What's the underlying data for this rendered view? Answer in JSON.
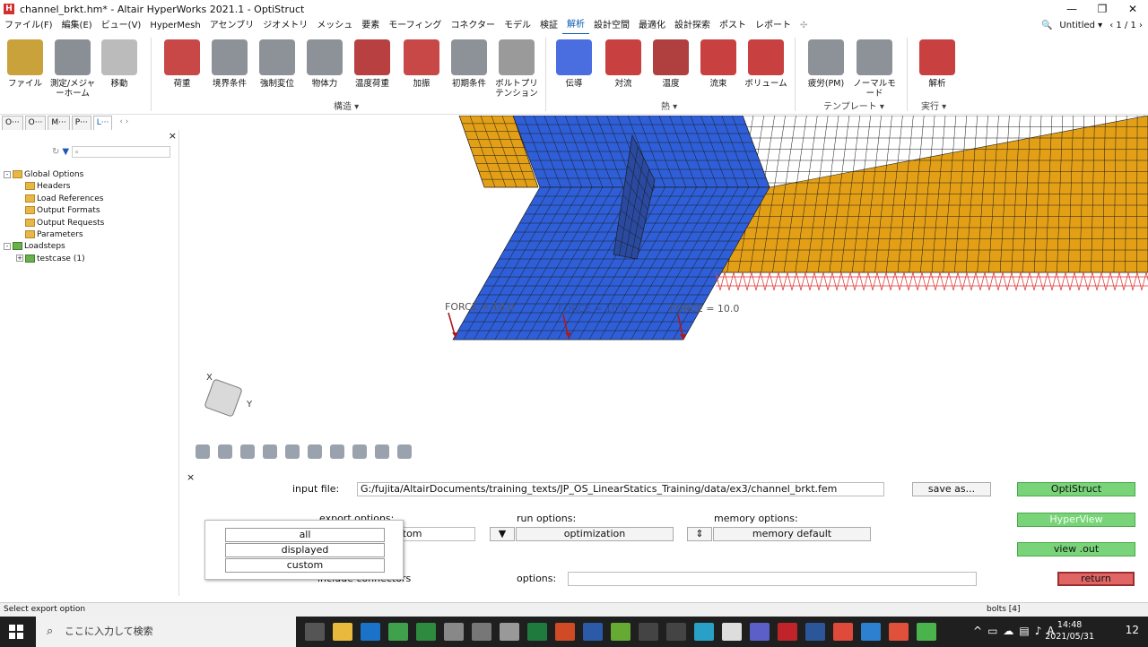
{
  "window": {
    "title": "channel_brkt.hm* - Altair HyperWorks 2021.1 - OptiStruct",
    "app_icon": "hyperworks-icon",
    "minimize": "—",
    "maximize": "❐",
    "close": "✕"
  },
  "menubar": {
    "items": [
      "ファイル(F)",
      "編集(E)",
      "ビュー(V)",
      "HyperMesh",
      "アセンブリ",
      "ジオメトリ",
      "メッシュ",
      "要素",
      "モーフィング",
      "コネクター",
      "モデル",
      "検証",
      "解析",
      "設計空間",
      "最適化",
      "設計探索",
      "ポスト",
      "レポート"
    ],
    "active_index": 12,
    "add_symbol": "✣",
    "search_icon": "🔍",
    "session": "Untitled ▾",
    "page": "‹ 1 / 1 ›"
  },
  "ribbon": {
    "buttons": [
      {
        "label": "ファイル",
        "color": "#c9a23c"
      },
      {
        "label": "測定/メジャーホーム",
        "color": "#8a8f96"
      },
      {
        "label": "移動",
        "color": "#bbbbbb"
      },
      {
        "label": "荷重",
        "color": "#c84848"
      },
      {
        "label": "境界条件",
        "color": "#8c9298"
      },
      {
        "label": "強制変位",
        "color": "#8c9298"
      },
      {
        "label": "物体力",
        "color": "#8c9298"
      },
      {
        "label": "温度荷重",
        "color": "#b84040"
      },
      {
        "label": "加振",
        "color": "#c84848"
      },
      {
        "label": "初期条件",
        "color": "#8c9298"
      },
      {
        "label": "ボルトプリテンション",
        "color": "#9a9a9a"
      },
      {
        "label": "伝導",
        "color": "#4a6ee0"
      },
      {
        "label": "対流",
        "color": "#c84040"
      },
      {
        "label": "温度",
        "color": "#b04040"
      },
      {
        "label": "流束",
        "color": "#c84040"
      },
      {
        "label": "ボリューム",
        "color": "#c84040"
      },
      {
        "label": "疲労(PM)",
        "color": "#8c9298"
      },
      {
        "label": "ノーマルモード",
        "color": "#8c9298"
      },
      {
        "label": "解析",
        "color": "#c84040"
      }
    ],
    "groups": [
      {
        "label": "構造 ▾"
      },
      {
        "label": "熱 ▾"
      },
      {
        "label": "テンプレート ▾"
      },
      {
        "label": "実行 ▾"
      }
    ]
  },
  "browser": {
    "tabs": [
      "O···",
      "O···",
      "M···",
      "P···",
      "L···"
    ],
    "active_tab": 4,
    "scroll_arrows": "‹ ›",
    "close": "×",
    "filter_placeholder": "«",
    "tree": [
      {
        "label": "Global Options",
        "level": 0,
        "expander": "⊟",
        "icon": "folder"
      },
      {
        "label": "Headers",
        "level": 1,
        "icon": "folder"
      },
      {
        "label": "Load References",
        "level": 1,
        "icon": "folder"
      },
      {
        "label": "Output Formats",
        "level": 1,
        "icon": "folder"
      },
      {
        "label": "Output Requests",
        "level": 1,
        "icon": "folder"
      },
      {
        "label": "Parameters",
        "level": 1,
        "icon": "folder"
      },
      {
        "label": "Loadsteps",
        "level": 0,
        "expander": "⊟",
        "icon": "loadstep"
      },
      {
        "label": "testcase (1)",
        "level": 1,
        "expander": "⊞",
        "icon": "loadstep"
      }
    ]
  },
  "viewport": {
    "force_labels": [
      "FORCE = 10.0",
      "FORCE = 10.0",
      "FORCE = 10.0"
    ],
    "axis_x": "X",
    "axis_y": "Y",
    "mesh_colors": {
      "flange": "#e3a017",
      "web": "#2f5fd8",
      "constraint": "#e23b3b"
    }
  },
  "export_panel": {
    "input_file_label": "input file:",
    "input_file_value": "G:/fujita/AltairDocuments/training_texts/JP_OS_LinearStatics_Training/data/ex3/channel_brkt.fem",
    "save_as": "save as...",
    "export_options_label": "export options:",
    "export_value_hidden": "custom",
    "run_options_label": "run options:",
    "run_options_value": "optimization",
    "memory_options_label": "memory options:",
    "memory_options_value": "memory default",
    "include_connectors": "include connectors",
    "options_label": "options:",
    "options_value": "",
    "optistruct": "OptiStruct",
    "hyperview": "HyperView",
    "view_out": "view .out",
    "return": "return",
    "close": "×",
    "dropdown_options": [
      "all",
      "displayed",
      "custom"
    ]
  },
  "status": {
    "message": "Select export option",
    "bolts": "bolts [4]"
  },
  "taskbar": {
    "search_placeholder": "ここに入力して検索",
    "time": "14:48",
    "date": "2021/05/31",
    "ime": "A",
    "notifications": "12"
  }
}
